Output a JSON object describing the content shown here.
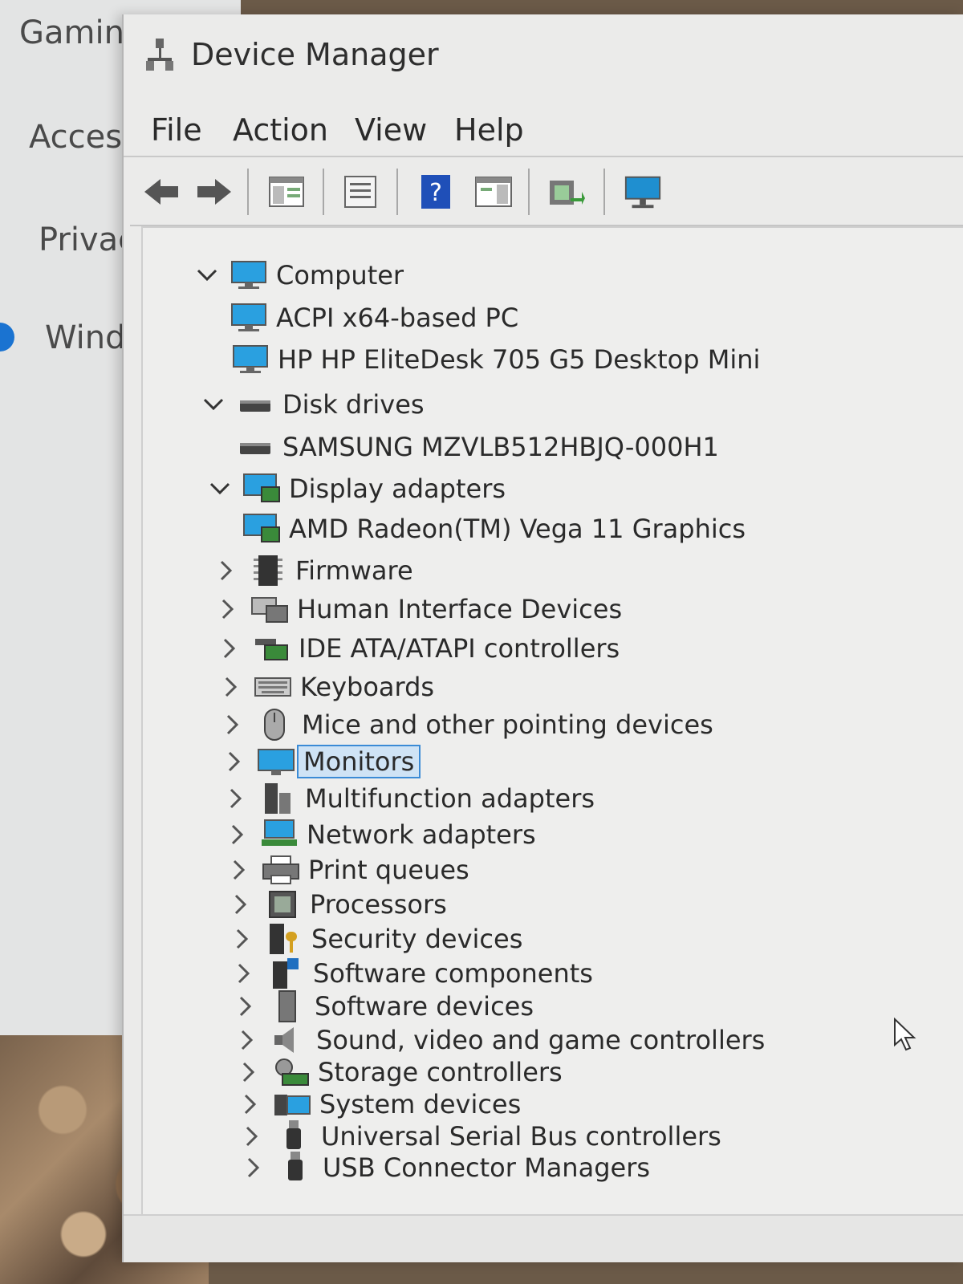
{
  "settings": {
    "nav": [
      "Gamin",
      "Access",
      "Privacy",
      "Windo"
    ]
  },
  "window": {
    "title": "Device Manager"
  },
  "menu": [
    "File",
    "Action",
    "View",
    "Help"
  ],
  "toolbar": [
    {
      "name": "back-arrow-icon"
    },
    {
      "name": "forward-arrow-icon"
    },
    {
      "name": "show-hide-console-tree-icon"
    },
    {
      "name": "properties-icon"
    },
    {
      "name": "help-icon"
    },
    {
      "name": "action-pane-icon"
    },
    {
      "name": "update-driver-icon"
    },
    {
      "name": "scan-hardware-changes-icon"
    }
  ],
  "tree": [
    {
      "label": "Computer",
      "level": 0,
      "expanded": true,
      "icon": "computer-icon"
    },
    {
      "label": "ACPI x64-based PC",
      "level": 1,
      "icon": "computer-icon"
    },
    {
      "label": "HP HP EliteDesk 705 G5 Desktop Mini",
      "level": 1,
      "icon": "computer-icon"
    },
    {
      "label": "Disk drives",
      "level": 0,
      "expanded": true,
      "icon": "disk-drive-icon"
    },
    {
      "label": "SAMSUNG MZVLB512HBJQ-000H1",
      "level": 1,
      "icon": "disk-drive-icon"
    },
    {
      "label": "Display adapters",
      "level": 0,
      "expanded": true,
      "icon": "display-adapter-icon"
    },
    {
      "label": "AMD Radeon(TM) Vega 11 Graphics",
      "level": 1,
      "icon": "display-adapter-icon"
    },
    {
      "label": "Firmware",
      "level": 0,
      "expanded": false,
      "icon": "firmware-icon"
    },
    {
      "label": "Human Interface Devices",
      "level": 0,
      "expanded": false,
      "icon": "hid-icon"
    },
    {
      "label": "IDE ATA/ATAPI controllers",
      "level": 0,
      "expanded": false,
      "icon": "ide-controller-icon"
    },
    {
      "label": "Keyboards",
      "level": 0,
      "expanded": false,
      "icon": "keyboard-icon"
    },
    {
      "label": "Mice and other pointing devices",
      "level": 0,
      "expanded": false,
      "icon": "mouse-icon"
    },
    {
      "label": "Monitors",
      "level": 0,
      "expanded": false,
      "icon": "monitor-icon",
      "selected": true
    },
    {
      "label": "Multifunction adapters",
      "level": 0,
      "expanded": false,
      "icon": "multifunction-icon"
    },
    {
      "label": "Network adapters",
      "level": 0,
      "expanded": false,
      "icon": "network-adapter-icon"
    },
    {
      "label": "Print queues",
      "level": 0,
      "expanded": false,
      "icon": "printer-icon"
    },
    {
      "label": "Processors",
      "level": 0,
      "expanded": false,
      "icon": "processor-icon"
    },
    {
      "label": "Security devices",
      "level": 0,
      "expanded": false,
      "icon": "security-device-icon"
    },
    {
      "label": "Software components",
      "level": 0,
      "expanded": false,
      "icon": "software-component-icon"
    },
    {
      "label": "Software devices",
      "level": 0,
      "expanded": false,
      "icon": "software-device-icon"
    },
    {
      "label": "Sound, video and game controllers",
      "level": 0,
      "expanded": false,
      "icon": "speaker-icon"
    },
    {
      "label": "Storage controllers",
      "level": 0,
      "expanded": false,
      "icon": "storage-controller-icon"
    },
    {
      "label": "System devices",
      "level": 0,
      "expanded": false,
      "icon": "system-device-icon"
    },
    {
      "label": "Universal Serial Bus controllers",
      "level": 0,
      "expanded": false,
      "icon": "usb-icon"
    },
    {
      "label": "USB Connector Managers",
      "level": 0,
      "expanded": false,
      "icon": "usb-icon"
    }
  ]
}
